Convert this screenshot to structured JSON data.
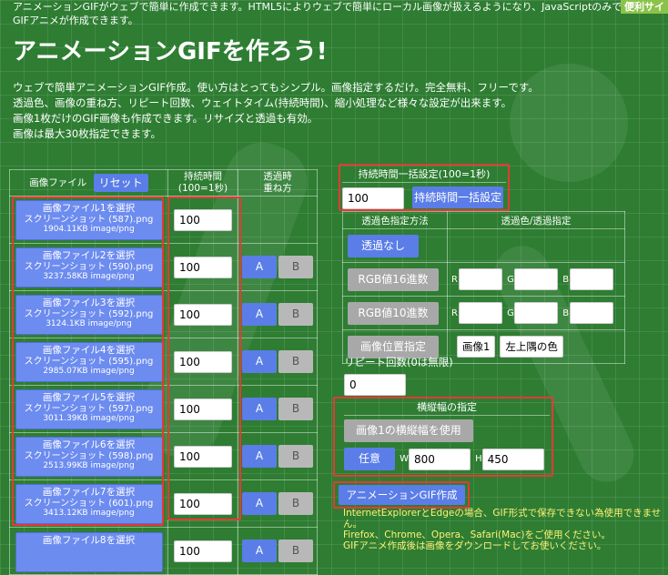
{
  "header": {
    "top_text": "アニメーションGIFがウェブで簡単に作成できます。HTML5によりウェブで簡単にローカル画像が扱えるようになり、JavaScriptのみでGIFアニメが作成できます。",
    "badge": "便利サイ",
    "title": "アニメーションGIFを作ろう!",
    "intro": [
      "ウェブで簡単アニメーションGIF作成。使い方はとってもシンプル。画像指定するだけ。完全無料、フリーです。",
      "透過色、画像の重ね方、リピート回数、ウェイトタイム(持続時間)、縮小処理など様々な設定が出来ます。",
      "画像1枚だけのGIF画像も作成できます。リサイズと透過も有効。",
      "画像は最大30枚指定できます。"
    ]
  },
  "files_table": {
    "header_file": "画像ファイル",
    "reset_label": "リセット",
    "header_duration": "持続時間\n(100=1秒)",
    "header_transparent": "透過時\n重ね方",
    "btn_a": "A",
    "btn_b": "B",
    "rows": [
      {
        "select": "画像ファイル1を選択",
        "name": "スクリーンショット (587).png",
        "info": "1904.11KB image/png",
        "duration": "100",
        "show_ab": false
      },
      {
        "select": "画像ファイル2を選択",
        "name": "スクリーンショット (590).png",
        "info": "3237.58KB image/png",
        "duration": "100",
        "show_ab": true
      },
      {
        "select": "画像ファイル3を選択",
        "name": "スクリーンショット (592).png",
        "info": "3124.1KB image/png",
        "duration": "100",
        "show_ab": true
      },
      {
        "select": "画像ファイル4を選択",
        "name": "スクリーンショット (595).png",
        "info": "2985.07KB image/png",
        "duration": "100",
        "show_ab": true
      },
      {
        "select": "画像ファイル5を選択",
        "name": "スクリーンショット (597).png",
        "info": "3011.39KB image/png",
        "duration": "100",
        "show_ab": true
      },
      {
        "select": "画像ファイル6を選択",
        "name": "スクリーンショット (598).png",
        "info": "2513.99KB image/png",
        "duration": "100",
        "show_ab": true
      },
      {
        "select": "画像ファイル7を選択",
        "name": "スクリーンショット (601).png",
        "info": "3413.12KB image/png",
        "duration": "100",
        "show_ab": true
      },
      {
        "select": "画像ファイル8を選択",
        "name": "",
        "info": "",
        "duration": "100",
        "show_ab": true
      }
    ]
  },
  "duration_bulk": {
    "heading": "持続時間一括設定(100=1秒)",
    "value": "100",
    "button": "持続時間一括設定"
  },
  "transparency": {
    "header_method": "透過色指定方法",
    "header_color": "透過色/透過指定",
    "none_button": "透過なし",
    "hex_button": "RGB値16進数",
    "dec_button": "RGB値10進数",
    "pos_button": "画像位置指定",
    "label_r": "R",
    "label_g": "G",
    "label_b": "B",
    "image_select": "画像1",
    "corner_select": "左上隅の色"
  },
  "repeat": {
    "label": "リピート回数(0は無限)",
    "value": "0"
  },
  "size": {
    "heading": "横縦幅の指定",
    "use_image_button": "画像1の横縦幅を使用",
    "custom_button": "任意",
    "label_w": "W",
    "label_h": "H",
    "width": "800",
    "height": "450"
  },
  "create": {
    "button": "アニメーションGIF作成",
    "notes": [
      "InternetExplorerとEdgeの場合、GIF形式で保存できない為使用できません。",
      "Firefox、Chrome、Opera、Safari(Mac)をご使用ください。",
      "GIFアニメ作成後は画像をダウンロードしてお使いください。"
    ]
  }
}
